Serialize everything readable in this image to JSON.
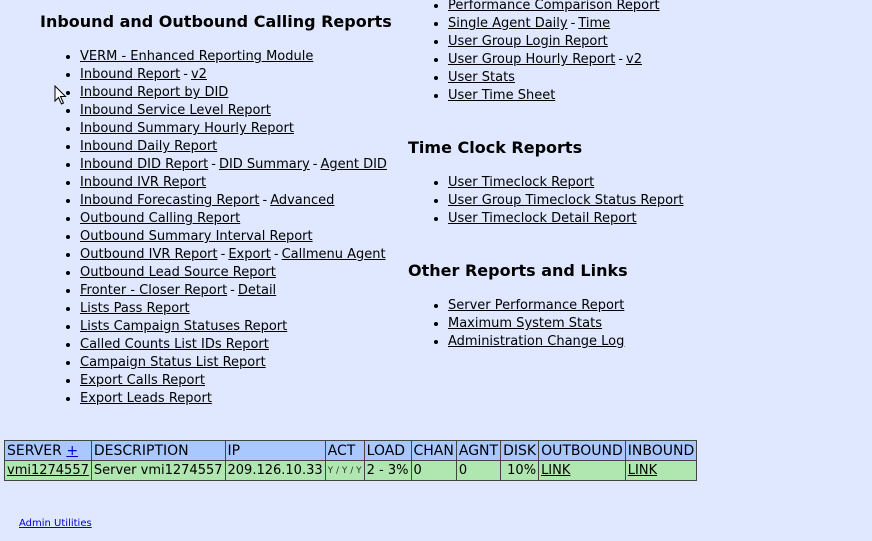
{
  "left": {
    "title": "Inbound and Outbound Calling Reports",
    "items": [
      {
        "parts": [
          "VERM - Enhanced Reporting Module"
        ]
      },
      {
        "parts": [
          "Inbound Report",
          "v2"
        ]
      },
      {
        "parts": [
          "Inbound Report by DID"
        ]
      },
      {
        "parts": [
          "Inbound Service Level Report"
        ]
      },
      {
        "parts": [
          "Inbound Summary Hourly Report"
        ]
      },
      {
        "parts": [
          "Inbound Daily Report"
        ]
      },
      {
        "parts": [
          "Inbound DID Report",
          "DID Summary",
          "Agent DID"
        ]
      },
      {
        "parts": [
          "Inbound IVR Report"
        ]
      },
      {
        "parts": [
          "Inbound Forecasting Report",
          "Advanced"
        ]
      },
      {
        "parts": [
          "Outbound Calling Report"
        ]
      },
      {
        "parts": [
          "Outbound Summary Interval Report"
        ]
      },
      {
        "parts": [
          "Outbound IVR Report",
          "Export",
          "Callmenu Agent"
        ]
      },
      {
        "parts": [
          "Outbound Lead Source Report"
        ]
      },
      {
        "parts": [
          "Fronter - Closer Report",
          "Detail"
        ]
      },
      {
        "parts": [
          "Lists Pass Report"
        ]
      },
      {
        "parts": [
          "Lists Campaign Statuses Report"
        ]
      },
      {
        "parts": [
          "Called Counts List IDs Report"
        ]
      },
      {
        "parts": [
          "Campaign Status List Report"
        ]
      },
      {
        "parts": [
          "Export Calls Report"
        ]
      },
      {
        "parts": [
          "Export Leads Report"
        ]
      }
    ]
  },
  "right": {
    "agent_items": [
      {
        "parts": [
          "Performance Comparison Report"
        ]
      },
      {
        "parts": [
          "Single Agent Daily",
          "Time"
        ]
      },
      {
        "parts": [
          "User Group Login Report"
        ]
      },
      {
        "parts": [
          "User Group Hourly Report",
          "v2"
        ]
      },
      {
        "parts": [
          "User Stats"
        ]
      },
      {
        "parts": [
          "User Time Sheet"
        ]
      }
    ],
    "timeclock_title": "Time Clock Reports",
    "timeclock_items": [
      {
        "parts": [
          "User Timeclock Report"
        ]
      },
      {
        "parts": [
          "User Group Timeclock Status Report"
        ]
      },
      {
        "parts": [
          "User Timeclock Detail Report"
        ]
      }
    ],
    "other_title": "Other Reports and Links",
    "other_items": [
      {
        "parts": [
          "Server Performance Report"
        ]
      },
      {
        "parts": [
          "Maximum System Stats"
        ]
      },
      {
        "parts": [
          "Administration Change Log"
        ]
      }
    ]
  },
  "separator": "-",
  "server_table": {
    "headers": {
      "server": "SERVER",
      "server_sort": "+",
      "description": "DESCRIPTION",
      "ip": "IP",
      "act": "ACT",
      "load": "LOAD",
      "chan": "CHAN",
      "agnt": "AGNT",
      "disk": "DISK",
      "outbound": "OUTBOUND",
      "inbound": "INBOUND"
    },
    "row": {
      "server": "vmi1274557",
      "description": "Server vmi1274557",
      "ip": "209.126.10.33",
      "act": "Y / Y / Y",
      "load": "2 - 3%",
      "chan": "0",
      "agnt": "0",
      "disk": "10%",
      "outbound": "LINK",
      "inbound": "LINK"
    }
  },
  "footer": {
    "admin_link": "Admin Utilities"
  }
}
